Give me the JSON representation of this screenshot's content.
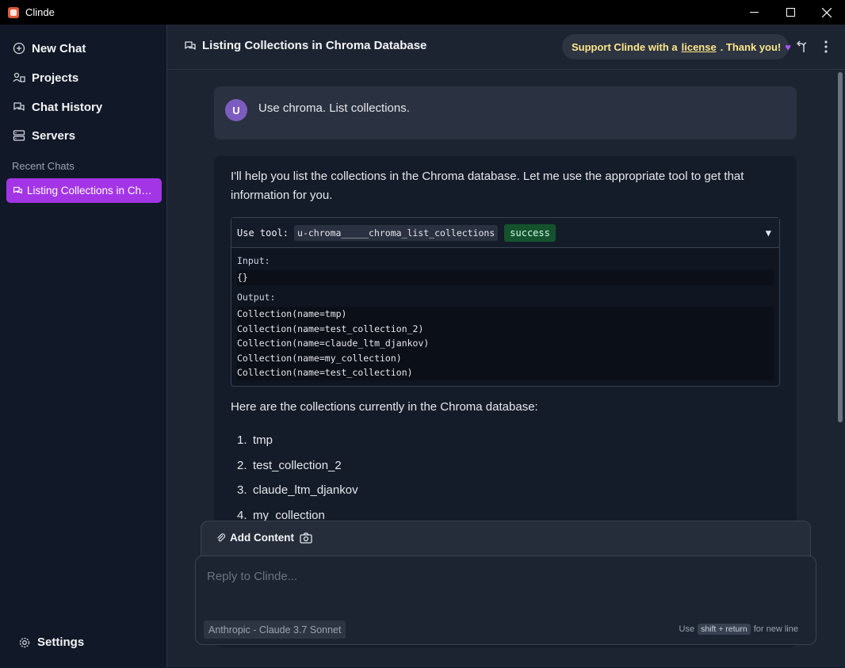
{
  "window": {
    "title": "Clinde",
    "minimize": "—",
    "maximize": "☐",
    "close": "✕"
  },
  "sidebar": {
    "items": [
      {
        "label": "New Chat",
        "icon": "plus-circle-icon"
      },
      {
        "label": "Projects",
        "icon": "projects-icon"
      },
      {
        "label": "Chat History",
        "icon": "chat-bubbles-icon"
      },
      {
        "label": "Servers",
        "icon": "server-icon"
      }
    ],
    "recent_label": "Recent Chats",
    "recent_chats": [
      {
        "label": "Listing Collections in Chroma Database"
      }
    ],
    "settings_label": "Settings"
  },
  "header": {
    "title": "Listing Collections in Chroma Database",
    "support_prefix": "Support Clinde with a",
    "support_link": "license",
    "support_suffix": ". Thank you!",
    "heart": "♥"
  },
  "conversation": {
    "user": {
      "avatar": "U",
      "text": "Use chroma. List collections."
    },
    "assistant": {
      "intro": "I'll help you list the collections in the Chroma database. Let me use the appropriate tool to get that information for you.",
      "tool": {
        "prefix": "Use tool:",
        "name": "u-chroma_____chroma_list_collections",
        "status": "success",
        "caret": "▼",
        "input_label": "Input:",
        "input": "{}",
        "output_label": "Output:",
        "output_lines": [
          "Collection(name=tmp)",
          "Collection(name=test_collection_2)",
          "Collection(name=claude_ltm_djankov)",
          "Collection(name=my_collection)",
          "Collection(name=test_collection)"
        ]
      },
      "after": "Here are the collections currently in the Chroma database:",
      "list": [
        {
          "num": "1.",
          "text": "tmp"
        },
        {
          "num": "2.",
          "text": "test_collection_2"
        },
        {
          "num": "3.",
          "text": "claude_ltm_djankov"
        },
        {
          "num": "4.",
          "text": "my_collection"
        }
      ]
    }
  },
  "composer": {
    "add_content": "Add Content",
    "placeholder": "Reply to Clinde...",
    "model": "Anthropic - Claude 3.7 Sonnet",
    "hint_prefix": "Use",
    "hint_key": "shift + return",
    "hint_suffix": "for new line"
  },
  "colors": {
    "accent": "#a335e6",
    "success": "#14532d",
    "support_text": "#fde68a"
  }
}
